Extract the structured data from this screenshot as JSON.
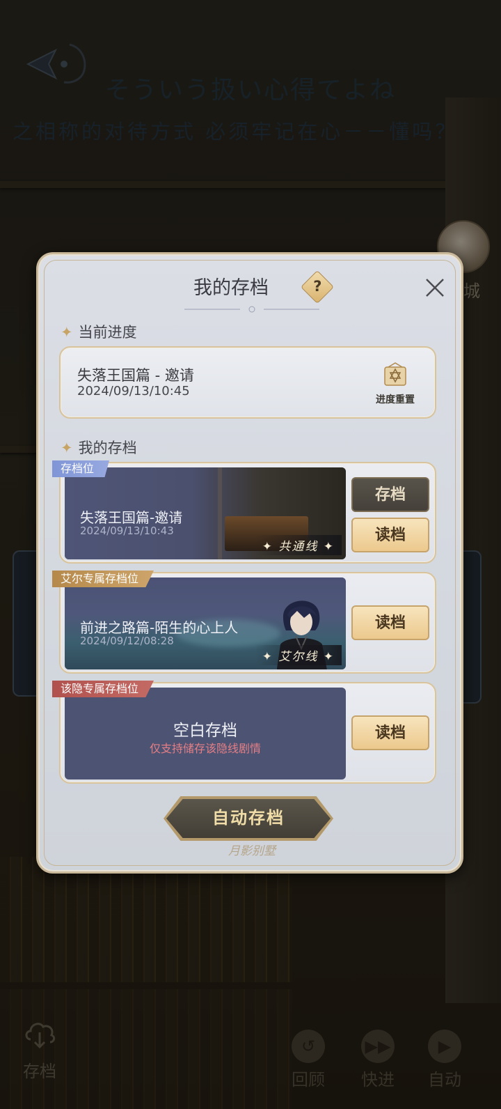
{
  "scene": {
    "line1": "そういう扱い心得てよね",
    "line2": "之相称的对待方式 必须牢记在心－－懂吗？",
    "shop_label": "商城",
    "bottom_nav": [
      {
        "label": "存档",
        "icon": "save-cloud-icon"
      },
      {
        "label": "回顾",
        "icon": "history-icon"
      },
      {
        "label": "快进",
        "icon": "fast-forward-icon"
      },
      {
        "label": "自动",
        "icon": "play-icon"
      }
    ]
  },
  "dialog": {
    "title": "我的存档",
    "help_label": "?",
    "current_section": "当前进度",
    "current": {
      "title": "失落王国篇 - 邀请",
      "time": "2024/09/13/10:45",
      "reset_label": "进度重置"
    },
    "slots_section": "我的存档",
    "slots": [
      {
        "ribbon": "存档位",
        "name": "失落王国篇-邀请",
        "time": "2024/09/13/10:43",
        "route": "共通线",
        "buttons": [
          "存档",
          "读档"
        ]
      },
      {
        "ribbon": "艾尔专属存档位",
        "name": "前进之路篇-陌生的心上人",
        "time": "2024/09/12/08:28",
        "route": "艾尔线",
        "buttons": [
          "读档"
        ]
      },
      {
        "ribbon": "该隐专属存档位",
        "empty_title": "空白存档",
        "empty_sub": "仅支持储存该隐线剧情",
        "buttons": [
          "读档"
        ]
      }
    ],
    "auto_save_label": "自动存档",
    "logo_text": "月影别墅"
  },
  "colors": {
    "ribbon_common": "#8aa0dc",
    "ribbon_el": "#c39a5e",
    "ribbon_cain": "#bc5c57",
    "gold_button": "#f2d6a2",
    "dark_button": "#4f4a42"
  }
}
